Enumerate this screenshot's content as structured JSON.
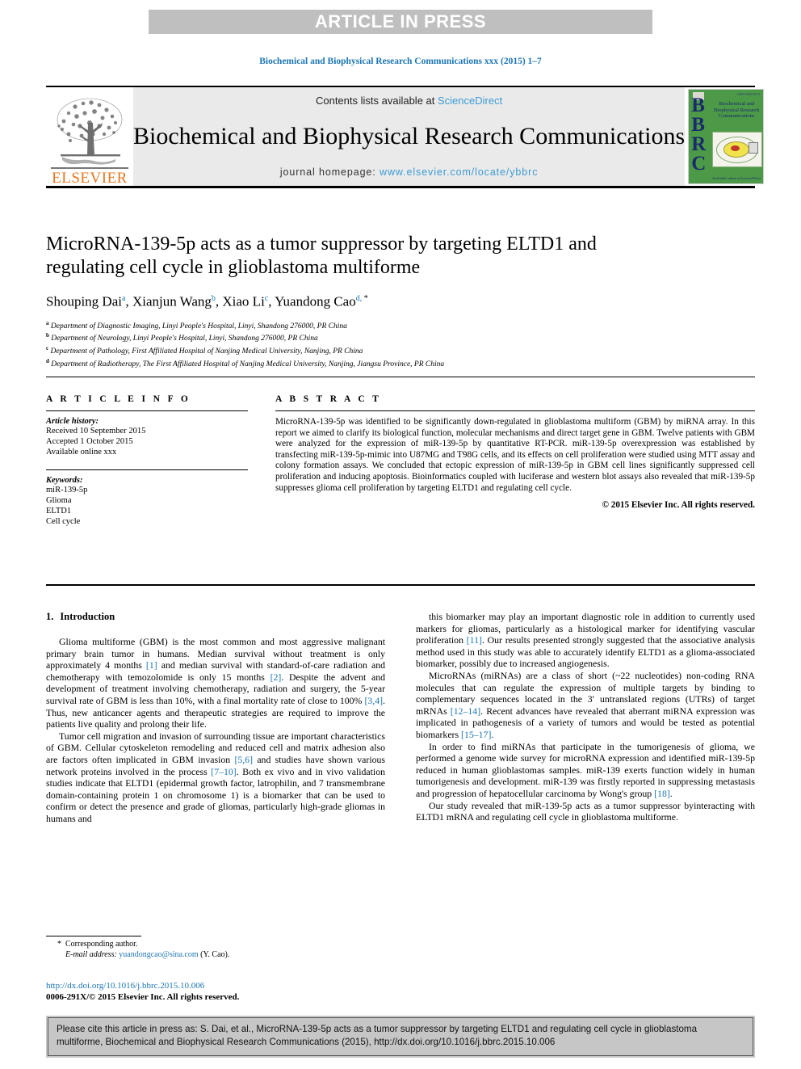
{
  "banner": {
    "label": "ARTICLE IN PRESS"
  },
  "running_head": "Biochemical and Biophysical Research Communications xxx (2015) 1–7",
  "masthead": {
    "publisher_logo_text": "ELSEVIER",
    "contents_prefix": "Contents lists available at ",
    "contents_link": "ScienceDirect",
    "journal_title": "Biochemical and Biophysical Research Communications",
    "homepage_prefix": "journal homepage: ",
    "homepage_url": "www.elsevier.com/locate/ybbrc",
    "cover": {
      "letters": "BBRC",
      "title_lines": "Biochemical and Biophysical Research Communications",
      "top_right": "ISSN 0006-291X",
      "bottom_lines": "Available online at ScienceDirect"
    },
    "colors": {
      "link_blue": "#3d9bd4",
      "elsevier_orange": "#e87722",
      "cover_green": "#4c9a48",
      "cover_navy": "#1b2a6b",
      "banner_grey": "#bfbfbf"
    }
  },
  "article": {
    "title": "MicroRNA-139-5p acts as a tumor suppressor by targeting ELTD1 and regulating cell cycle in glioblastoma multiforme",
    "authors": [
      {
        "name": "Shouping Dai",
        "sup": "a",
        "sep": ", "
      },
      {
        "name": "Xianjun Wang",
        "sup": "b",
        "sep": ", "
      },
      {
        "name": "Xiao Li",
        "sup": "c",
        "sep": ", "
      },
      {
        "name": "Yuandong Cao",
        "sup": "d, ",
        "star": "*",
        "sep": ""
      }
    ],
    "affiliations": [
      {
        "mark": "a",
        "text": "Department of Diagnostic Imaging, Linyi People's Hospital, Linyi, Shandong 276000, PR China"
      },
      {
        "mark": "b",
        "text": "Department of Neurology, Linyi People's Hospital, Linyi, Shandong 276000, PR China"
      },
      {
        "mark": "c",
        "text": "Department of Pathology, First Affiliated Hospital of Nanjing Medical University, Nanjing, PR China"
      },
      {
        "mark": "d",
        "text": "Department of Radiotherapy, The First Affiliated Hospital of Nanjing Medical University, Nanjing, Jiangsu Province, PR China"
      }
    ]
  },
  "article_info": {
    "heading": "A R T I C L E   I N F O",
    "history_label": "Article history:",
    "history": [
      "Received 10 September 2015",
      "Accepted 1 October 2015",
      "Available online xxx"
    ],
    "keywords_label": "Keywords:",
    "keywords": [
      "miR-139-5p",
      "Glioma",
      "ELTD1",
      "Cell cycle"
    ]
  },
  "abstract": {
    "heading": "A B S T R A C T",
    "text": "MicroRNA-139-5p was identified to be significantly down-regulated in glioblastoma multiform (GBM) by miRNA array. In this report we aimed to clarify its biological function, molecular mechanisms and direct target gene in GBM. Twelve patients with GBM were analyzed for the expression of miR-139-5p by quantitative RT-PCR. miR-139-5p overexpression was established by transfecting miR-139-5p-mimic into U87MG and T98G cells, and its effects on cell proliferation were studied using MTT assay and colony formation assays. We concluded that ectopic expression of miR-139-5p in GBM cell lines significantly suppressed cell proliferation and inducing apoptosis. Bioinformatics coupled with luciferase and western blot assays also revealed that miR-139-5p suppresses glioma cell proliferation by targeting ELTD1 and regulating cell cycle.",
    "copyright": "© 2015 Elsevier Inc. All rights reserved."
  },
  "introduction": {
    "number": "1.",
    "heading": "Introduction",
    "left_paragraphs": [
      "Glioma multiforme (GBM) is the most common and most aggressive malignant primary brain tumor in humans. Median survival without treatment is only approximately 4 months [1] and median survival with standard-of-care radiation and chemotherapy with temozolomide is only 15 months [2]. Despite the advent and development of treatment involving chemotherapy, radiation and surgery, the 5-year survival rate of GBM is less than 10%, with a final mortality rate of close to 100% [3,4]. Thus, new anticancer agents and therapeutic strategies are required to improve the patients live quality and prolong their life.",
      "Tumor cell migration and invasion of surrounding tissue are important characteristics of GBM. Cellular cytoskeleton remodeling and reduced cell and matrix adhesion also are factors often implicated in GBM invasion [5,6] and studies have shown various network proteins involved in the process [7–10]. Both ex vivo and in vivo validation studies indicate that ELTD1 (epidermal growth factor, latrophilin, and 7 transmembrane domain-containing protein 1 on chromosome 1) is a biomarker that can be used to confirm or detect the presence and grade of gliomas, particularly high-grade gliomas in humans and"
    ],
    "right_paragraphs": [
      "this biomarker may play an important diagnostic role in addition to currently used markers for gliomas, particularly as a histological marker for identifying vascular proliferation [11]. Our results presented strongly suggested that the associative analysis method used in this study was able to accurately identify ELTD1 as a glioma-associated biomarker, possibly due to increased angiogenesis.",
      "MicroRNAs (miRNAs) are a class of short (~22 nucleotides) non-coding RNA molecules that can regulate the expression of multiple targets by binding to complementary sequences located in the 3′ untranslated regions (UTRs) of target mRNAs [12–14]. Recent advances have revealed that aberrant miRNA expression was implicated in pathogenesis of a variety of tumors and would be tested as potential biomarkers [15–17].",
      "In order to find miRNAs that participate in the tumorigenesis of glioma, we performed a genome wide survey for microRNA expression and identified miR-139-5p reduced in human glioblastomas samples. miR-139 exerts function widely in human tumorigenesis and development. miR-139 was firstly reported in suppressing metastasis and progression of hepatocellular carcinoma by Wong's group [18].",
      "Our study revealed that miR-139-5p acts as a tumor suppressor byinteracting with ELTD1 mRNA and regulating cell cycle in glioblastoma multiforme."
    ]
  },
  "footnotes": {
    "corresponding_star": "*",
    "corresponding_label": "Corresponding author.",
    "email_label": "E-mail address:",
    "email": "yuandongcao@sina.com",
    "email_suffix": "(Y. Cao).",
    "doi_url": "http://dx.doi.org/10.1016/j.bbrc.2015.10.006",
    "issn_line": "0006-291X/© 2015 Elsevier Inc. All rights reserved."
  },
  "citation_box": {
    "text": "Please cite this article in press as: S. Dai, et al., MicroRNA-139-5p acts as a tumor suppressor by targeting ELTD1 and regulating cell cycle in glioblastoma multiforme, Biochemical and Biophysical Research Communications (2015), http://dx.doi.org/10.1016/j.bbrc.2015.10.006"
  }
}
